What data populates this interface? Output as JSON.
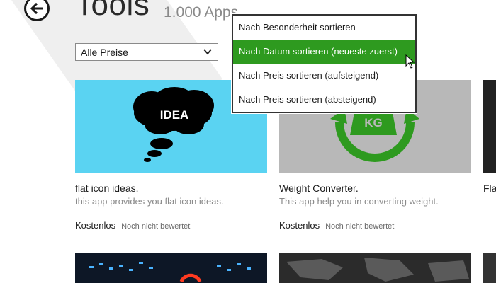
{
  "header": {
    "title": "Tools",
    "app_count": "1.000 Apps"
  },
  "filter": {
    "price_value": "Alle Preise"
  },
  "sort_menu": {
    "items": [
      {
        "label": "Nach Besonderheit sortieren",
        "selected": false
      },
      {
        "label": "Nach Datum sortieren (neueste zuerst)",
        "selected": true
      },
      {
        "label": "Nach Preis sortieren (aufsteigend)",
        "selected": false
      },
      {
        "label": "Nach Preis sortieren (absteigend)",
        "selected": false
      }
    ]
  },
  "apps": [
    {
      "name": "flat icon ideas.",
      "description": "this app provides you flat icon ideas.",
      "price": "Kostenlos",
      "rating": "Noch nicht bewertet",
      "image_text": "IDEA",
      "icon": "idea-cloud-icon",
      "bg_color": "#5ad3f2"
    },
    {
      "name": "Weight Converter.",
      "description": "This app help you in converting weight.",
      "price": "Kostenlos",
      "rating": "Noch nicht bewertet",
      "image_text": "KG",
      "icon": "weight-convert-icon",
      "bg_color": "#b8b8b8"
    },
    {
      "name": "Fla",
      "description": "",
      "price": "",
      "rating": "",
      "icon": "app-tile-icon",
      "bg_color": "#222222"
    }
  ],
  "colors": {
    "accent": "#2e9a1f",
    "muted_text": "#8a8a8a"
  }
}
